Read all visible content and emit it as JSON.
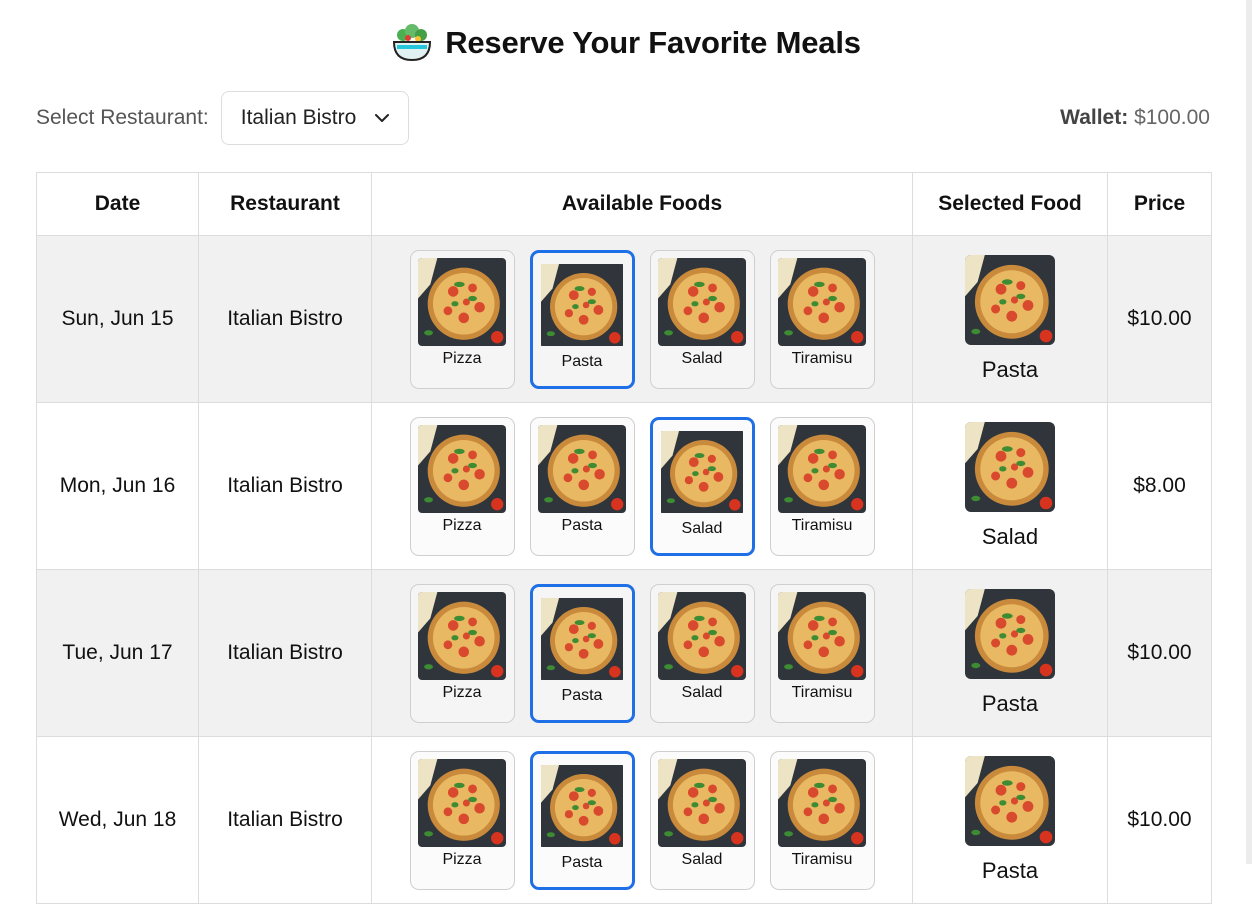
{
  "page": {
    "title": "Reserve Your Favorite Meals",
    "title_icon": "salad-bowl-icon"
  },
  "controls": {
    "restaurant_label": "Select Restaurant:",
    "restaurant_value": "Italian Bistro",
    "wallet_label": "Wallet:",
    "wallet_value": "$100.00"
  },
  "table": {
    "headers": [
      "Date",
      "Restaurant",
      "Available Foods",
      "Selected Food",
      "Price"
    ],
    "rows": [
      {
        "date": "Sun, Jun 15",
        "restaurant": "Italian Bistro",
        "foods": [
          "Pizza",
          "Pasta",
          "Salad",
          "Tiramisu"
        ],
        "selected_index": 1,
        "selected_food": "Pasta",
        "price": "$10.00"
      },
      {
        "date": "Mon, Jun 16",
        "restaurant": "Italian Bistro",
        "foods": [
          "Pizza",
          "Pasta",
          "Salad",
          "Tiramisu"
        ],
        "selected_index": 2,
        "selected_food": "Salad",
        "price": "$8.00"
      },
      {
        "date": "Tue, Jun 17",
        "restaurant": "Italian Bistro",
        "foods": [
          "Pizza",
          "Pasta",
          "Salad",
          "Tiramisu"
        ],
        "selected_index": 1,
        "selected_food": "Pasta",
        "price": "$10.00"
      },
      {
        "date": "Wed, Jun 18",
        "restaurant": "Italian Bistro",
        "foods": [
          "Pizza",
          "Pasta",
          "Salad",
          "Tiramisu"
        ],
        "selected_index": 1,
        "selected_food": "Pasta",
        "price": "$10.00"
      }
    ]
  },
  "colors": {
    "selected_border": "#1f6fe6",
    "row_shade": "#f1f1f1"
  }
}
